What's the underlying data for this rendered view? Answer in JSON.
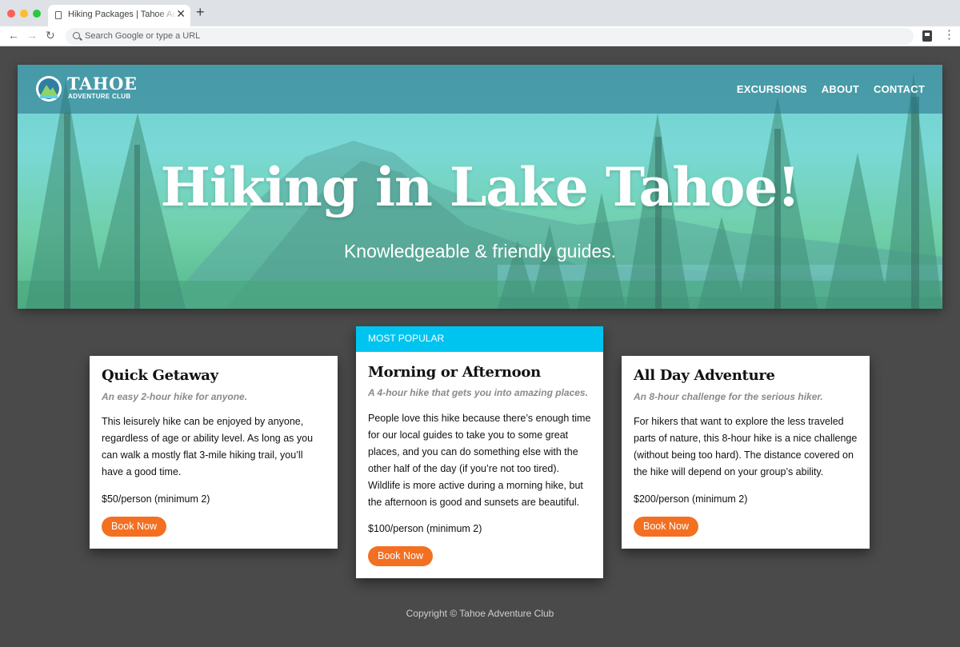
{
  "browser": {
    "tab_title": "Hiking Packages | Tahoe Adventure Club",
    "tab_close": "✕",
    "new_tab": "+",
    "back": "←",
    "forward": "→",
    "reload": "↻",
    "omnibox_placeholder": "Search Google or type a URL",
    "menu": "⋮"
  },
  "site": {
    "logo_name": "TAHOE",
    "logo_sub": "ADVENTURE CLUB",
    "nav": [
      "EXCURSIONS",
      "ABOUT",
      "CONTACT"
    ]
  },
  "hero": {
    "title": "Hiking in Lake Tahoe!",
    "subtitle": "Knowledgeable & friendly guides."
  },
  "packages": [
    {
      "title": "Quick Getaway",
      "tagline": "An easy 2-hour hike for anyone.",
      "description": "This leisurely hike can be enjoyed by anyone, regardless of age or ability level. As long as you can walk a mostly flat 3-mile hiking trail, you’ll have a good time.",
      "price": "$50/person (minimum 2)",
      "button": "Book Now"
    },
    {
      "badge": "MOST POPULAR",
      "title": "Morning or Afternoon",
      "tagline": "A 4-hour hike that gets you into amazing places.",
      "description": "People love this hike because there’s enough time for our local guides to take you to some great places, and you can do something else with the other half of the day (if you’re not too tired). Wildlife is more active during a morning hike, but the afternoon is good and sunsets are beautiful.",
      "price": "$100/person (minimum 2)",
      "button": "Book Now"
    },
    {
      "title": "All Day Adventure",
      "tagline": "An 8-hour challenge for the serious hiker.",
      "description": "For hikers that want to explore the less traveled parts of nature, this 8-hour hike is a nice challenge (without being too hard). The distance covered on the hike will depend on your group’s ability.",
      "price": "$200/person (minimum 2)",
      "button": "Book Now"
    }
  ],
  "footer": {
    "copyright": "Copyright © Tahoe Adventure Club"
  },
  "colors": {
    "accent": "#00c4f0",
    "button": "#f37022",
    "page_background": "#4a4a4a"
  }
}
